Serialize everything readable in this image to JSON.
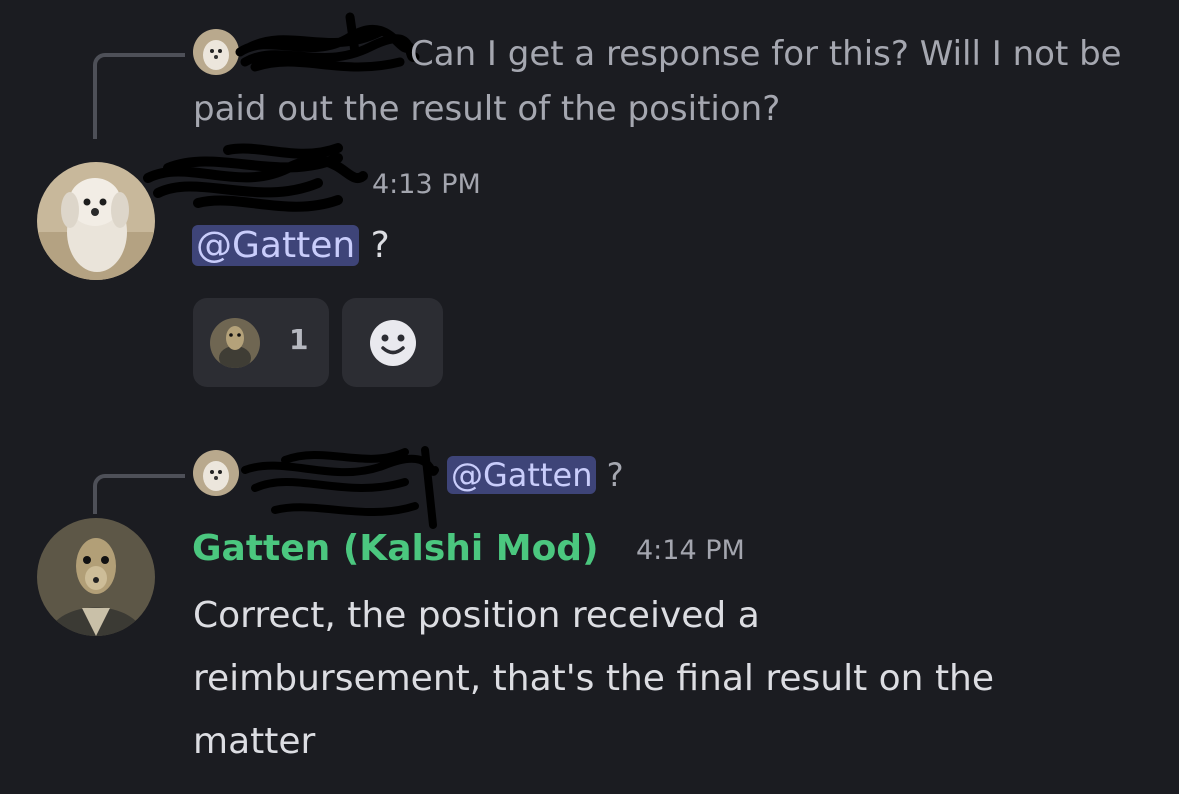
{
  "messages": [
    {
      "reply_preview": {
        "text_line1": "Can I get a response for this? Will I not be",
        "text_line2": "paid out the result of the position?"
      },
      "author": "",
      "timestamp": "4:13 PM",
      "content": {
        "mention": "@Gatten",
        "suffix": " ?"
      },
      "reactions": [
        {
          "icon": "meerkat-avatar-icon",
          "count": "1"
        },
        {
          "icon": "add-reaction-smiley-icon"
        }
      ]
    },
    {
      "reply_preview": {
        "mention": "@Gatten",
        "suffix": " ?"
      },
      "author": "Gatten (Kalshi Mod)",
      "author_color": "#4bc77f",
      "timestamp": "4:14 PM",
      "content": {
        "line1": "Correct, the position received a",
        "line2": "reimbursement, that's the final result on the",
        "line3": "matter"
      }
    }
  ],
  "colors": {
    "background": "#1b1c21",
    "mention_bg": "#3e4478",
    "mention_text": "#c9cdfb",
    "mod_name": "#4bc77f"
  }
}
